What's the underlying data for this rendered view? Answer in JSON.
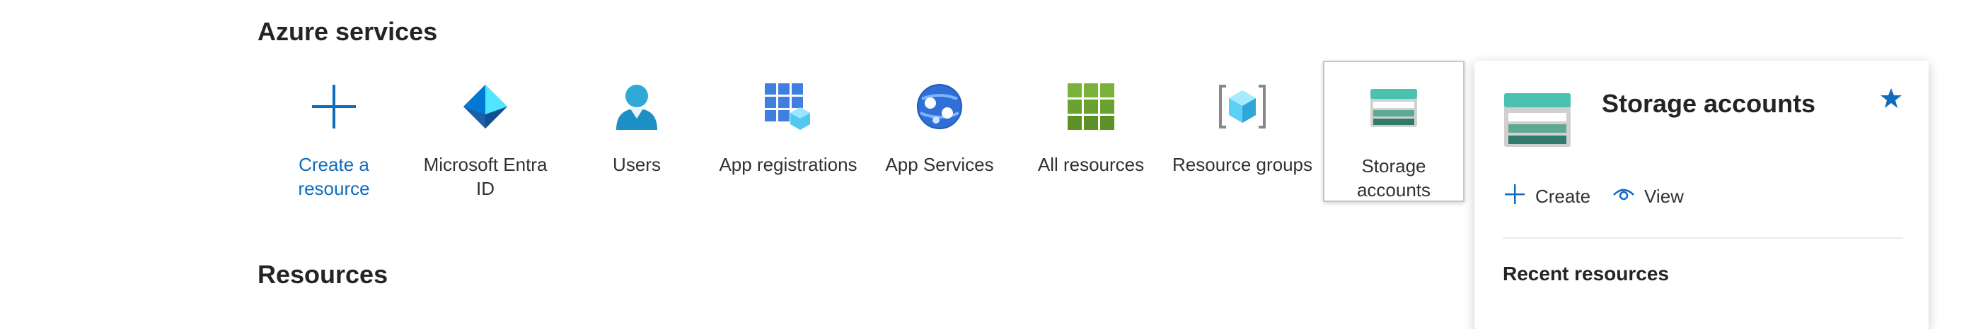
{
  "azure_services": {
    "title": "Azure services",
    "tiles": [
      {
        "label": "Create a resource",
        "icon": "plus-icon"
      },
      {
        "label": "Microsoft Entra ID",
        "icon": "entra-id-icon"
      },
      {
        "label": "Users",
        "icon": "user-icon"
      },
      {
        "label": "App registrations",
        "icon": "app-registrations-icon"
      },
      {
        "label": "App Services",
        "icon": "app-services-icon"
      },
      {
        "label": "All resources",
        "icon": "all-resources-grid-icon"
      },
      {
        "label": "Resource groups",
        "icon": "resource-groups-icon"
      },
      {
        "label": "Storage accounts",
        "icon": "storage-accounts-icon"
      }
    ]
  },
  "resources": {
    "title": "Resources"
  },
  "flyout": {
    "title": "Storage accounts",
    "favorite_icon": "star-icon",
    "actions": [
      {
        "label": "Create",
        "icon": "plus-icon"
      },
      {
        "label": "View",
        "icon": "eye-icon"
      }
    ],
    "recent_title": "Recent resources"
  },
  "colors": {
    "link_blue": "#0f6cbd",
    "text": "#323130",
    "heading": "#242424"
  }
}
